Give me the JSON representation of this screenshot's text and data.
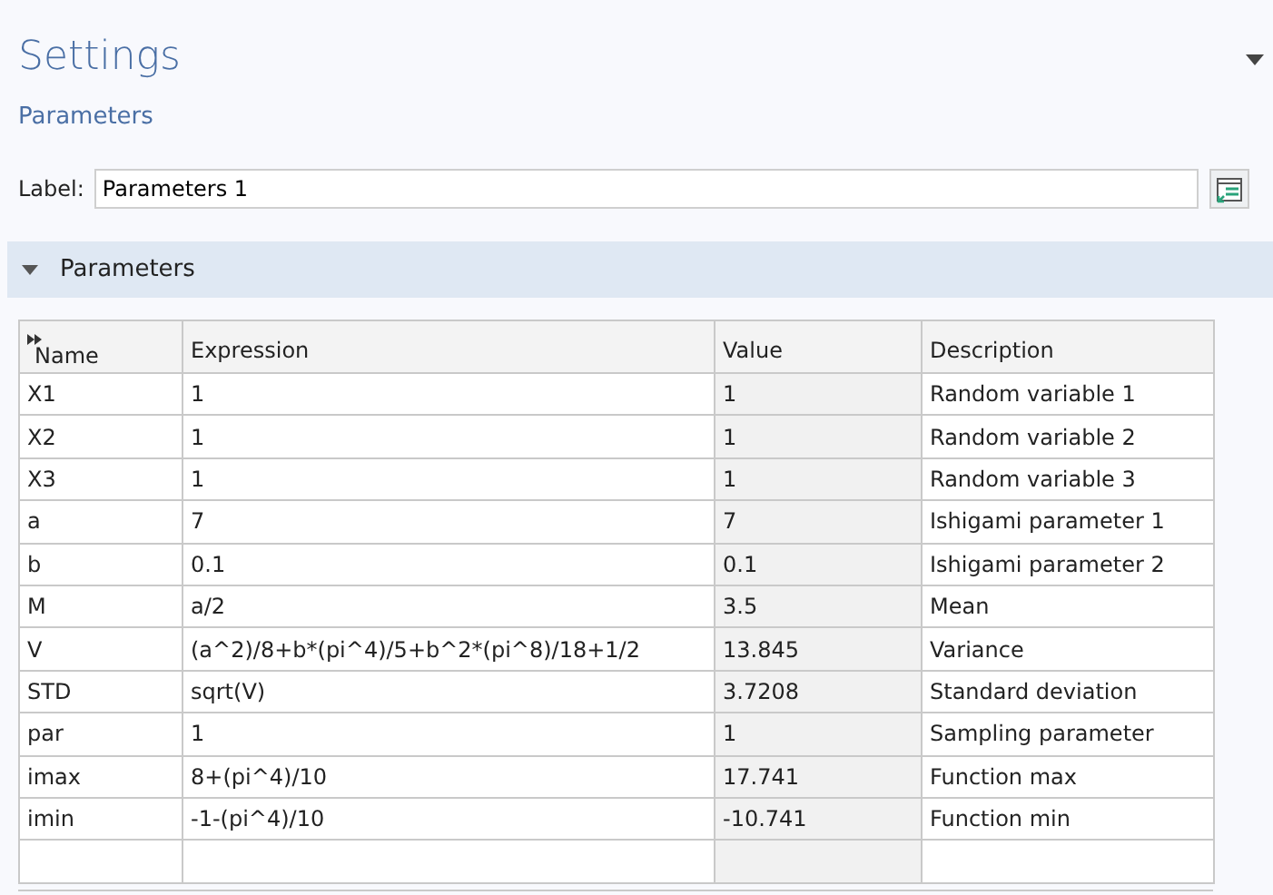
{
  "panel": {
    "title": "Settings",
    "subtitle": "Parameters"
  },
  "label_field": {
    "label": "Label:",
    "value": "Parameters 1"
  },
  "section": {
    "title": "Parameters",
    "expanded": true
  },
  "table": {
    "columns": [
      "Name",
      "Expression",
      "Value",
      "Description"
    ],
    "rows": [
      {
        "name": "X1",
        "expression": "1",
        "value": "1",
        "description": "Random variable 1"
      },
      {
        "name": "X2",
        "expression": "1",
        "value": "1",
        "description": "Random variable 2"
      },
      {
        "name": "X3",
        "expression": "1",
        "value": "1",
        "description": "Random variable 3"
      },
      {
        "name": "a",
        "expression": "7",
        "value": "7",
        "description": "Ishigami parameter 1"
      },
      {
        "name": "b",
        "expression": "0.1",
        "value": "0.1",
        "description": "Ishigami parameter 2"
      },
      {
        "name": "M",
        "expression": "a/2",
        "value": "3.5",
        "description": "Mean"
      },
      {
        "name": "V",
        "expression": "(a^2)/8+b*(pi^4)/5+b^2*(pi^8)/18+1/2",
        "value": "13.845",
        "description": "Variance"
      },
      {
        "name": "STD",
        "expression": "sqrt(V)",
        "value": "3.7208",
        "description": "Standard deviation"
      },
      {
        "name": "par",
        "expression": "1",
        "value": "1",
        "description": "Sampling parameter"
      },
      {
        "name": "imax",
        "expression": "8+(pi^4)/10",
        "value": "17.741",
        "description": "Function max"
      },
      {
        "name": "imin",
        "expression": "-1-(pi^4)/10",
        "value": "-10.741",
        "description": "Function min"
      }
    ]
  }
}
